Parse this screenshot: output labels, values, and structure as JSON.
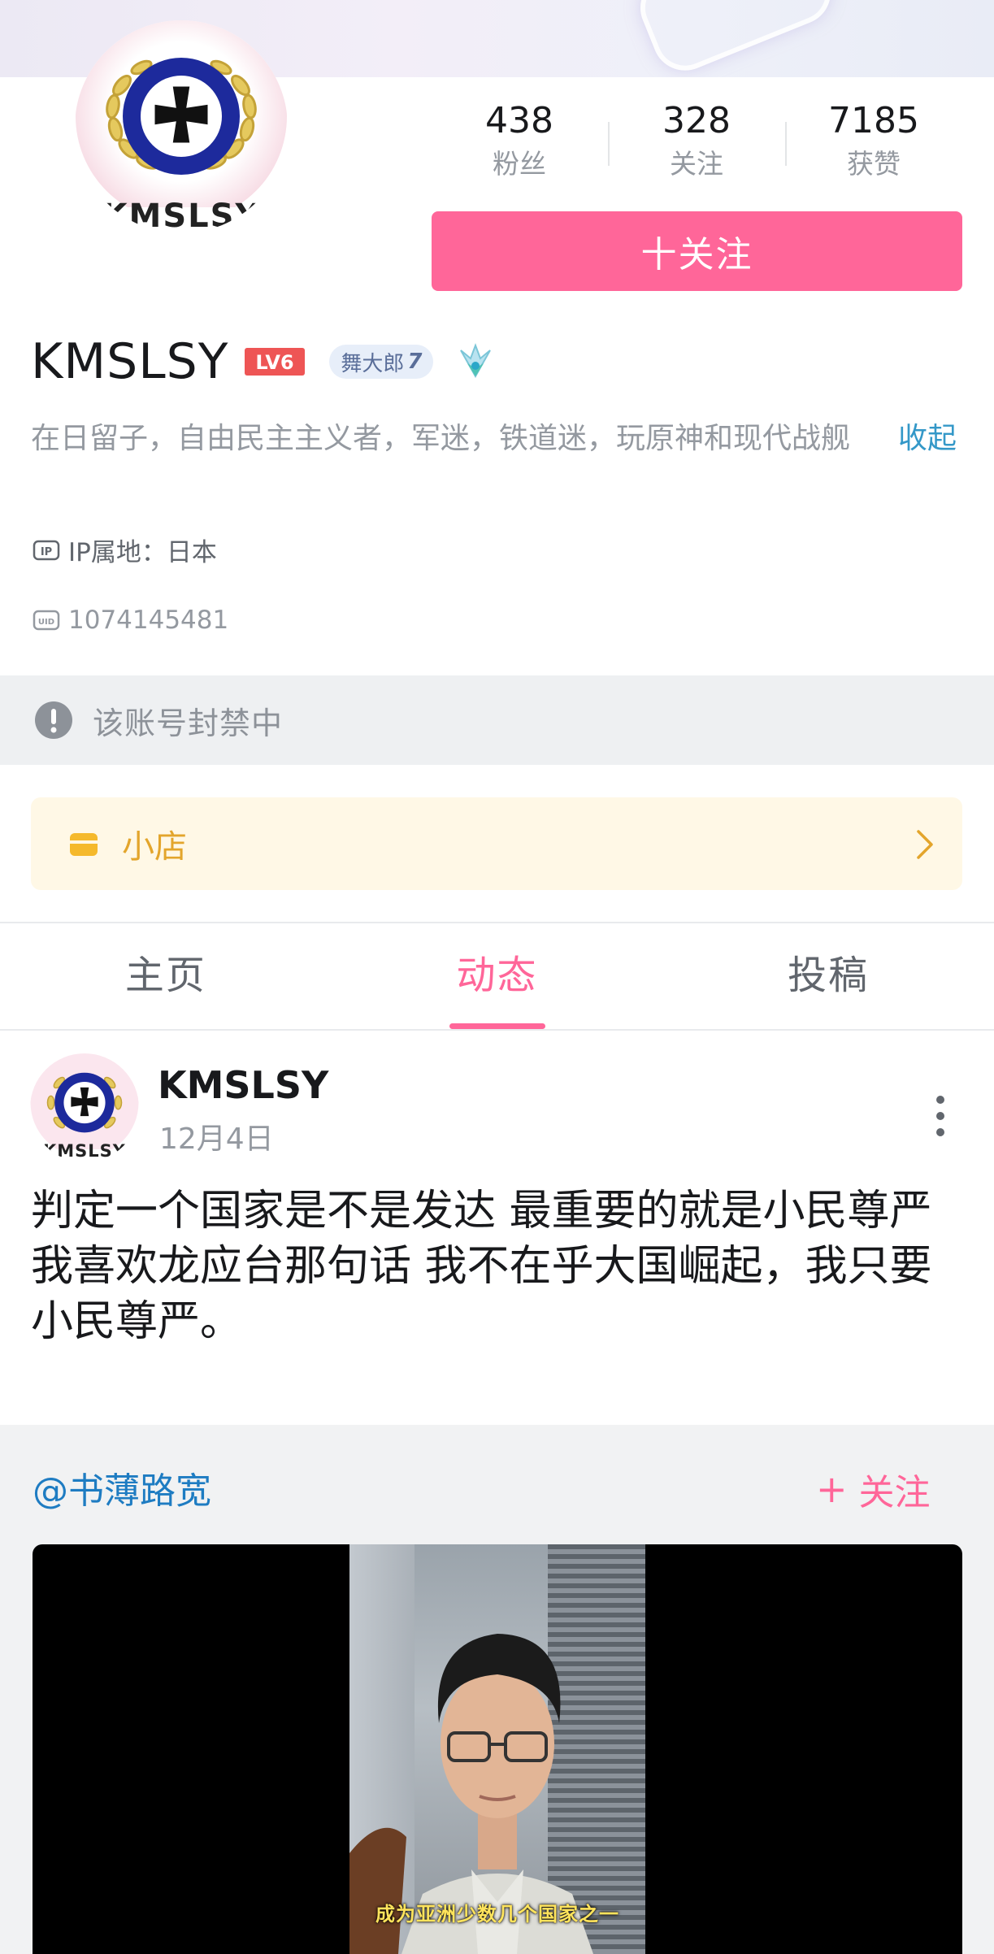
{
  "profile": {
    "avatar_text": "KMSLSY",
    "username": "KMSLSY",
    "level_badge": "LV6",
    "medal": {
      "name": "舞大郎",
      "level": "7"
    },
    "stats": [
      {
        "value": "438",
        "label": "粉丝"
      },
      {
        "value": "328",
        "label": "关注"
      },
      {
        "value": "7185",
        "label": "获赞"
      }
    ],
    "follow_button": "十关注",
    "bio": "在日留子，自由民主主义者，军迷，铁道迷，玩原神和现代战舰",
    "collapse_label": "收起",
    "ip_location": "IP属地：日本",
    "uid": "1074145481",
    "banned_notice": "该账号封禁中",
    "shop_label": "小店"
  },
  "tabs": [
    {
      "label": "主页",
      "active": false
    },
    {
      "label": "动态",
      "active": true
    },
    {
      "label": "投稿",
      "active": false
    }
  ],
  "post": {
    "avatar_text": "KMSLSY",
    "author": "KMSLSY",
    "date": "12月4日",
    "text": "判定一个国家是不是发达 最重要的就是小民尊严 我喜欢龙应台那句话 我不在乎大国崛起，我只要小民尊严。",
    "repost": {
      "author": "@书薄路宽",
      "follow_label": "关注",
      "video_subtitle": "成为亚洲少数几个国家之一"
    }
  },
  "colors": {
    "accent": "#ff6699",
    "link": "#1e7cc2",
    "shop": "#e3a52c",
    "banned_bg": "#eef0f2"
  },
  "icons": [
    "ip-icon",
    "uid-icon",
    "alert-icon",
    "shop-icon",
    "chevron-right-icon",
    "more-vertical-icon",
    "iron-cross-emblem-icon",
    "pendant-icon"
  ]
}
